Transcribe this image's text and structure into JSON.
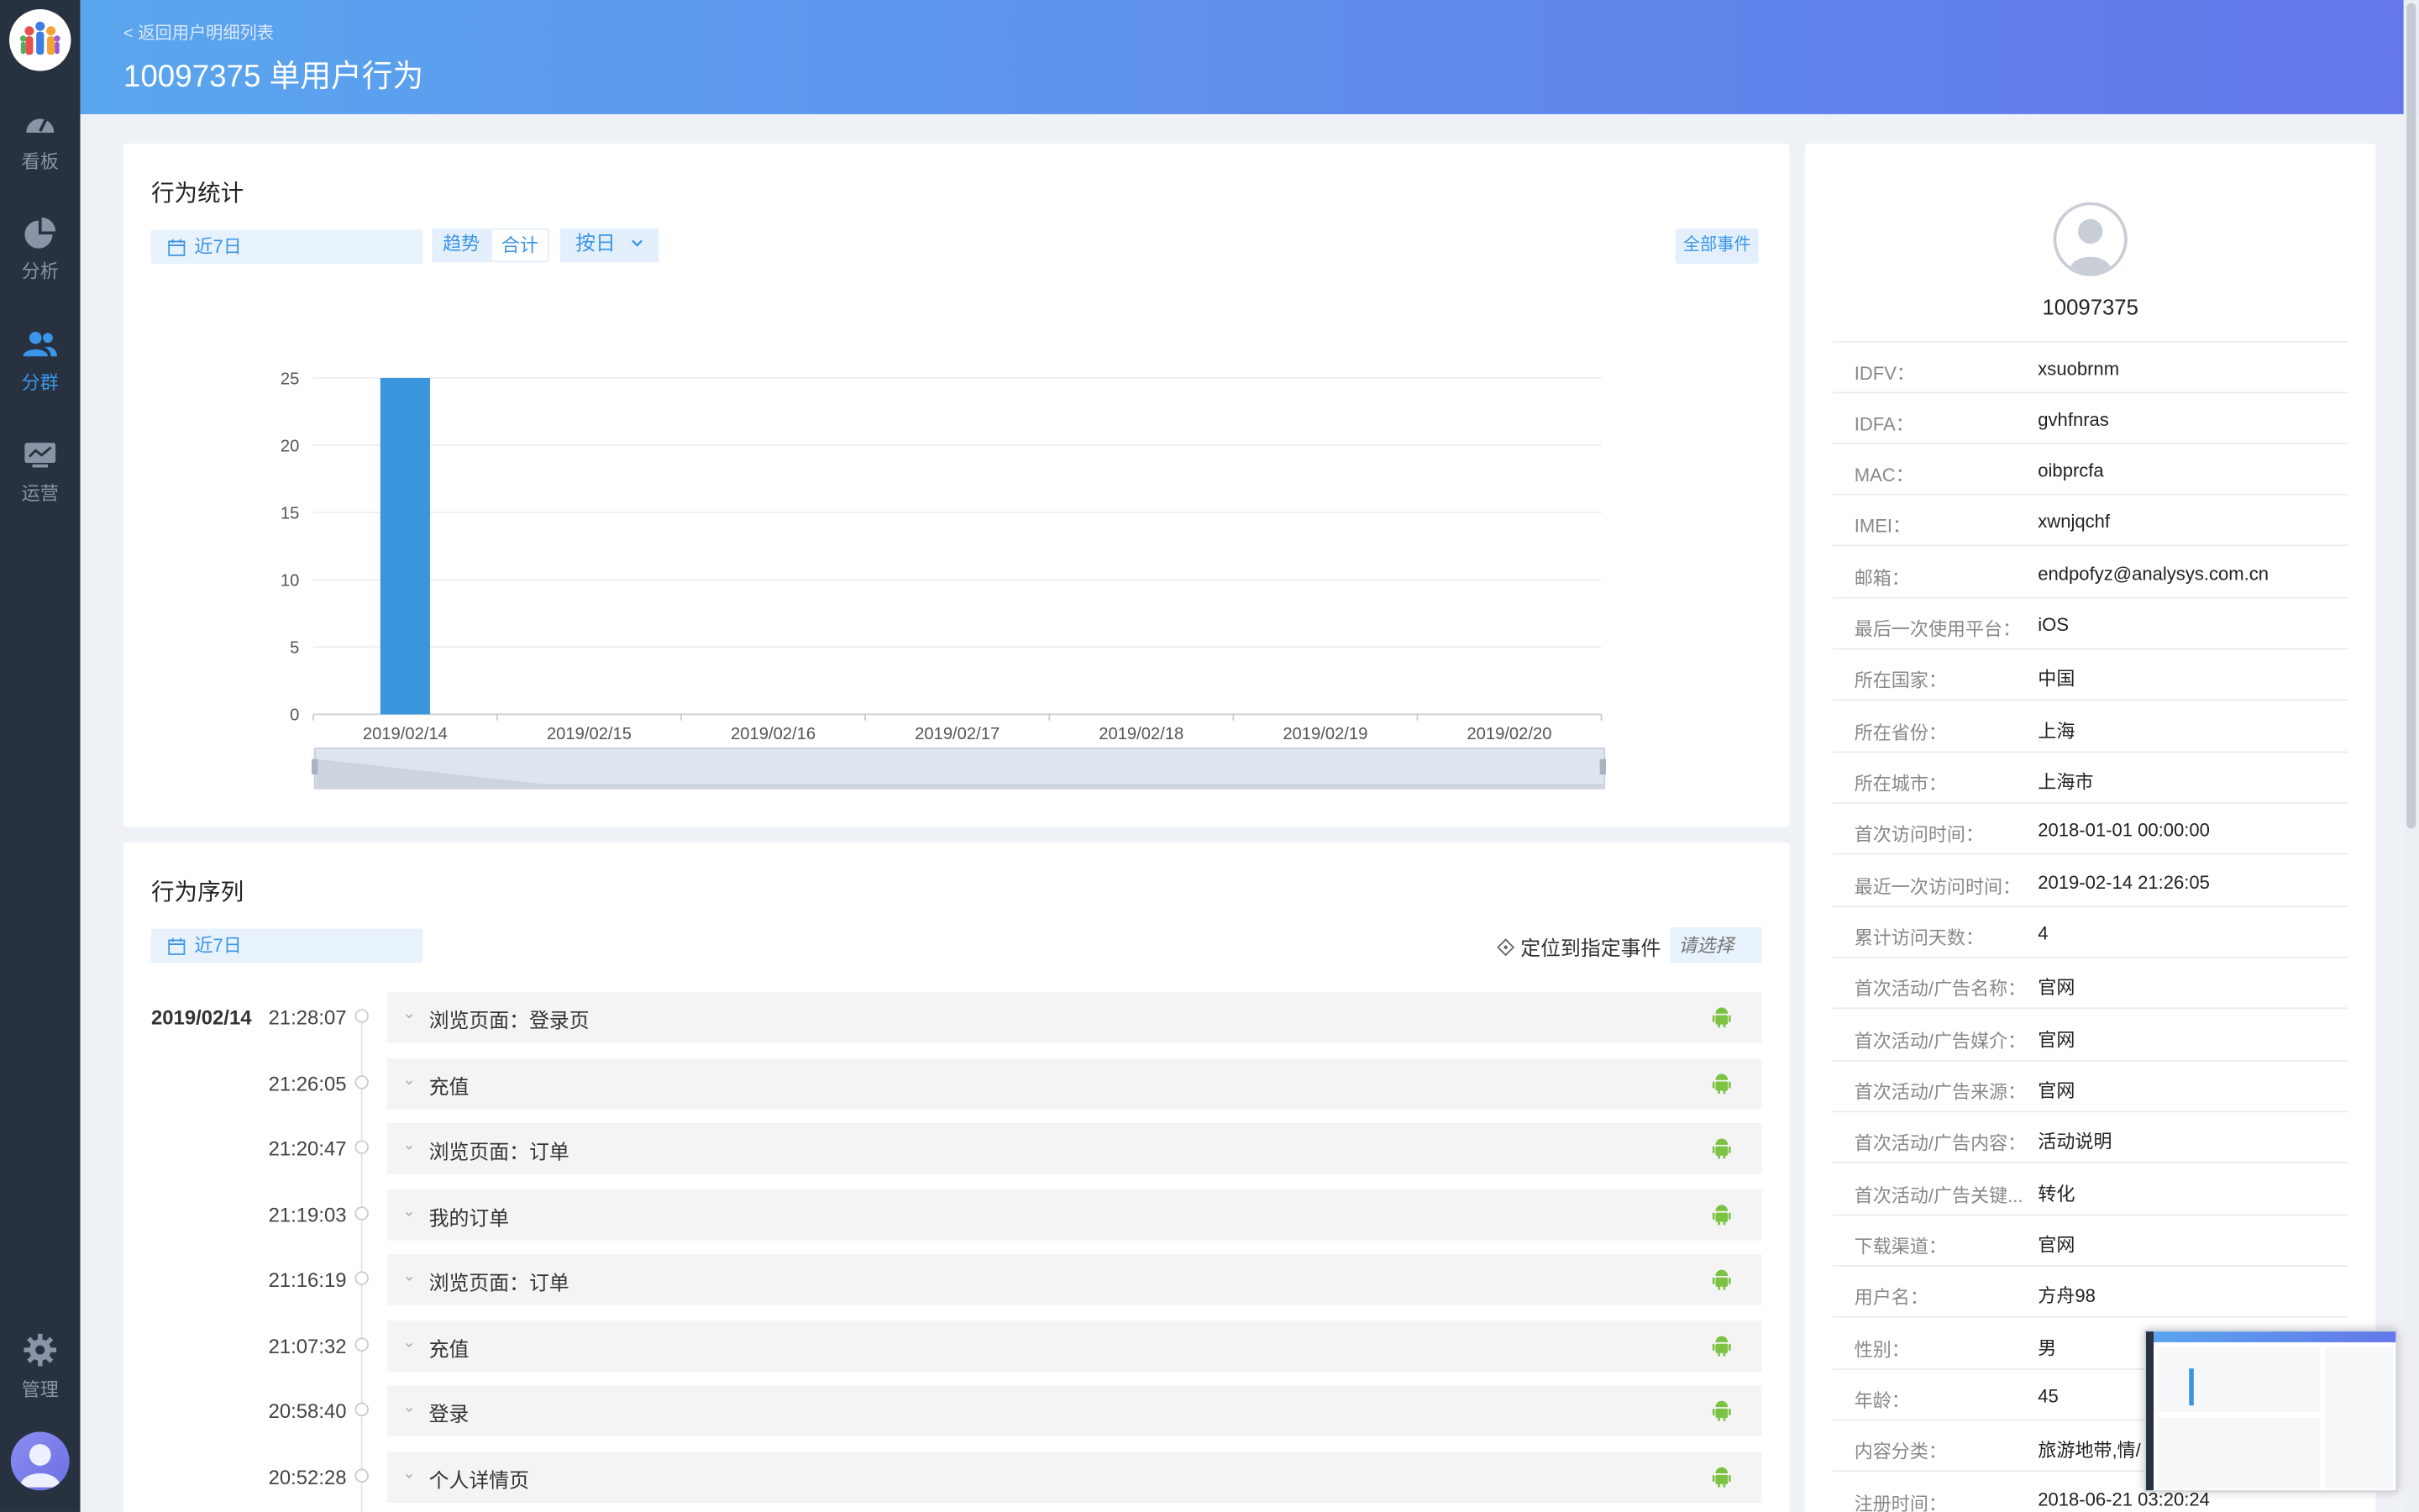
{
  "sidebar": {
    "items": [
      {
        "label": "看板",
        "icon": "dashboard-icon"
      },
      {
        "label": "分析",
        "icon": "pie-chart-icon"
      },
      {
        "label": "分群",
        "icon": "users-icon",
        "active": true
      },
      {
        "label": "运营",
        "icon": "monitor-icon"
      }
    ],
    "bottom": {
      "label": "管理",
      "icon": "gear-icon"
    }
  },
  "header": {
    "back_link": "< 返回用户明细列表",
    "title": "10097375 单用户行为"
  },
  "stats": {
    "title": "行为统计",
    "date_range": "近7日",
    "tab_trend": "趋势",
    "tab_total": "合计",
    "granularity": "按日",
    "all_events_button": "全部事件"
  },
  "chart_data": {
    "type": "bar",
    "categories": [
      "2019/02/14",
      "2019/02/15",
      "2019/02/16",
      "2019/02/17",
      "2019/02/18",
      "2019/02/19",
      "2019/02/20"
    ],
    "values": [
      25,
      0,
      0,
      0,
      0,
      0,
      0
    ],
    "y_ticks": [
      "0",
      "5",
      "10",
      "15",
      "20",
      "25"
    ],
    "ylim": [
      0,
      25
    ],
    "grid": true,
    "bar_color": "#3b95dd"
  },
  "sequence": {
    "title": "行为序列",
    "date_range": "近7日",
    "locate_label": "定位到指定事件",
    "select_placeholder": "请选择",
    "date": "2019/02/14",
    "events": [
      {
        "time": "21:28:07",
        "label": "浏览页面：登录页"
      },
      {
        "time": "21:26:05",
        "label": "充值"
      },
      {
        "time": "21:20:47",
        "label": "浏览页面：订单"
      },
      {
        "time": "21:19:03",
        "label": "我的订单"
      },
      {
        "time": "21:16:19",
        "label": "浏览页面：订单"
      },
      {
        "time": "21:07:32",
        "label": "充值"
      },
      {
        "time": "20:58:40",
        "label": "登录"
      },
      {
        "time": "20:52:28",
        "label": "个人详情页"
      }
    ]
  },
  "profile": {
    "user_id": "10097375",
    "fields": [
      {
        "key": "IDFV：",
        "value": "xsuobrnm"
      },
      {
        "key": "IDFA：",
        "value": "gvhfnras"
      },
      {
        "key": "MAC：",
        "value": "oibprcfa"
      },
      {
        "key": "IMEI：",
        "value": "xwnjqchf"
      },
      {
        "key": "邮箱：",
        "value": "endpofyz@analysys.com.cn"
      },
      {
        "key": "最后一次使用平台：",
        "value": "iOS"
      },
      {
        "key": "所在国家：",
        "value": "中国"
      },
      {
        "key": "所在省份：",
        "value": "上海"
      },
      {
        "key": "所在城市：",
        "value": "上海市"
      },
      {
        "key": "首次访问时间：",
        "value": "2018-01-01 00:00:00"
      },
      {
        "key": "最近一次访问时间：",
        "value": "2019-02-14 21:26:05"
      },
      {
        "key": "累计访问天数：",
        "value": "4"
      },
      {
        "key": "首次活动/广告名称：",
        "value": "官网"
      },
      {
        "key": "首次活动/广告媒介：",
        "value": "官网"
      },
      {
        "key": "首次活动/广告来源：",
        "value": "官网"
      },
      {
        "key": "首次活动/广告内容：",
        "value": "活动说明"
      },
      {
        "key": "首次活动/广告关键...",
        "value": "转化"
      },
      {
        "key": "下载渠道：",
        "value": "官网"
      },
      {
        "key": "用户名：",
        "value": "方舟98"
      },
      {
        "key": "性别：",
        "value": "男"
      },
      {
        "key": "年龄：",
        "value": "45"
      },
      {
        "key": "内容分类：",
        "value": "旅游地带,情/"
      },
      {
        "key": "注册时间：",
        "value": "2018-06-21 03:20:24"
      }
    ]
  },
  "colors": {
    "accent": "#3b95e8",
    "sidebar_bg": "#28313f",
    "android_green": "#7cc243"
  }
}
